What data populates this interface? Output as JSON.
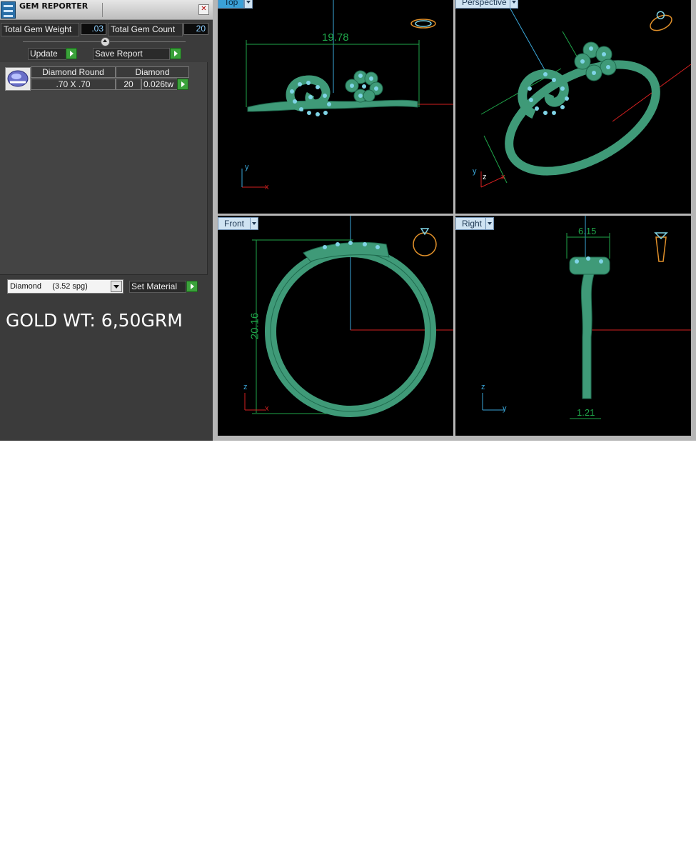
{
  "panel": {
    "title": "GEM REPORTER",
    "close": "✕",
    "total_gem_weight_label": "Total Gem Weight",
    "total_gem_weight_value": ".03",
    "total_gem_count_label": "Total Gem Count",
    "total_gem_count_value": "20",
    "update_label": "Update",
    "save_report_label": "Save Report"
  },
  "gem_table": {
    "header_shape": "Diamond Round",
    "header_material": "Diamond",
    "row": {
      "size": ".70 X .70",
      "count": "20",
      "weight": "0.026tw"
    }
  },
  "material": {
    "selected": "Diamond     (3.52 spg)",
    "set_label": "Set Material"
  },
  "gold_weight": "GOLD WT: 6,50GRM",
  "viewports": {
    "top": {
      "label": "Top",
      "dimension": "19.78",
      "axis_a": "y",
      "axis_b": "x"
    },
    "perspective": {
      "label": "Perspective",
      "axis_a": "y",
      "axis_b": "z",
      "axis_c": "x"
    },
    "front": {
      "label": "Front",
      "dimension": "20.16",
      "axis_a": "z",
      "axis_b": "x"
    },
    "right": {
      "label": "Right",
      "dimension_top": "6.15",
      "dimension_bottom": "1.21",
      "axis_a": "z",
      "axis_b": "y"
    }
  },
  "colors": {
    "model": "#3f9a78",
    "gem": "#7fd4e6",
    "dimension": "#1fa64a",
    "axis_red": "#d42020",
    "axis_blue": "#3aa6d8",
    "accent": "#3aa23a"
  },
  "icons": [
    "gem-reporter-icon",
    "close-icon",
    "collapse-icon",
    "go-arrow-icon",
    "dropdown-arrow-icon",
    "ring-preview-icon"
  ]
}
